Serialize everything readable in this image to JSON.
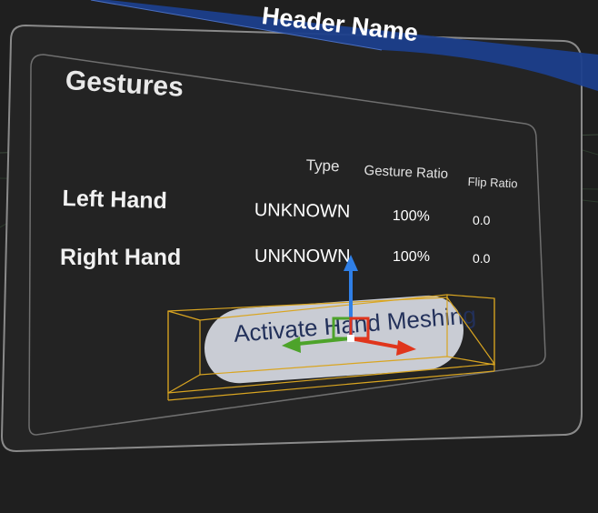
{
  "window": {
    "header_title": "Header Name"
  },
  "panel": {
    "title": "Gestures",
    "columns": {
      "type": "Type",
      "gesture_ratio": "Gesture Ratio",
      "flip_ratio": "Flip Ratio"
    },
    "rows": [
      {
        "label": "Left Hand",
        "type": "UNKNOWN",
        "gesture_ratio": "100%",
        "flip_ratio": "0.0"
      },
      {
        "label": "Right Hand",
        "type": "UNKNOWN",
        "gesture_ratio": "100%",
        "flip_ratio": "0.0"
      }
    ],
    "action_button": {
      "label": "Activate Hand Meshing"
    }
  },
  "colors": {
    "background": "#1f1f1f",
    "header_bar": "#1c3f8c",
    "button_fill": "#c9ccd4",
    "button_text": "#22305a",
    "selection_box": "#d9a521",
    "gizmo_y": "#2f7fe6",
    "gizmo_x": "#e0351c",
    "gizmo_z": "#4da32a"
  },
  "icons": {
    "transform_gizmo": "move-gizmo-icon"
  }
}
